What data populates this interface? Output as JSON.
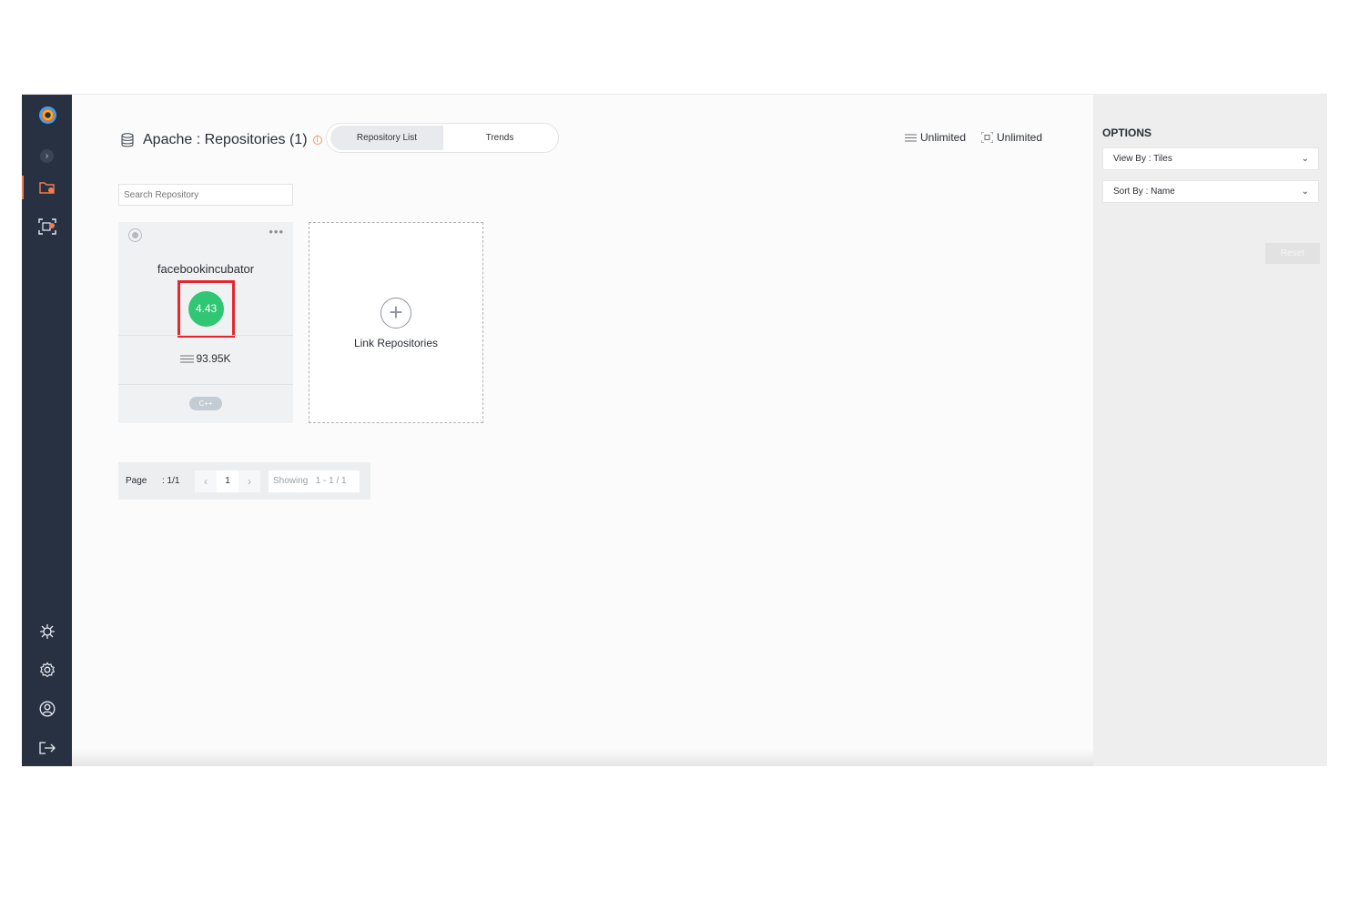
{
  "header": {
    "title": "Apache : Repositories (1)",
    "tabs": [
      {
        "label": "Repository List",
        "active": true
      },
      {
        "label": "Trends",
        "active": false
      }
    ],
    "quota_loc": "Unlimited",
    "quota_scan": "Unlimited"
  },
  "search": {
    "placeholder": "Search Repository"
  },
  "repo_card": {
    "name": "facebookincubator",
    "score": "4.43",
    "loc": "93.95K",
    "language": "C++",
    "more_label": "•••"
  },
  "link_card": {
    "label": "Link Repositories"
  },
  "pagination": {
    "page_label": "Page",
    "page_count": ": 1/1",
    "current_page": "1",
    "showing_label": "Showing",
    "showing_range": "1 - 1 / 1"
  },
  "options": {
    "title": "OPTIONS",
    "view_by": "View By : Tiles",
    "sort_by": "Sort By : Name",
    "reset_label": "Reset"
  },
  "colors": {
    "sidebar_bg": "#283142",
    "accent": "#f07c52",
    "score_green": "#2fc674",
    "highlight_red": "#e5262d"
  },
  "icons": {
    "sidebar_top": [
      "app-logo-icon",
      "expand-icon",
      "repositories-folder-icon",
      "scan-icon"
    ],
    "sidebar_bottom": [
      "integrations-icon",
      "settings-icon",
      "user-profile-icon",
      "logout-icon"
    ]
  }
}
